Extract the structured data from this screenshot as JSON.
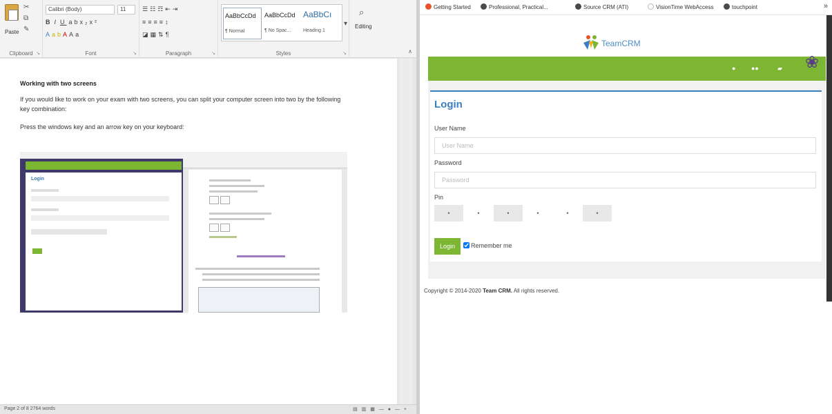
{
  "word": {
    "ribbon": {
      "clipboard": {
        "paste_label": "Paste",
        "group_label": "Clipboard"
      },
      "font": {
        "name": "Calibri (Body)",
        "size": "11",
        "group_label": "Font"
      },
      "paragraph": {
        "group_label": "Paragraph"
      },
      "styles": {
        "group_label": "Styles",
        "items": [
          {
            "preview": "AaBbCcDd",
            "name": "¶ Normal"
          },
          {
            "preview": "AaBbCcDd",
            "name": "¶ No Spac..."
          },
          {
            "preview": "AaBbCı",
            "name": "Heading 1"
          }
        ]
      },
      "editing": {
        "label": "Editing"
      }
    },
    "document": {
      "heading": "Working with two screens",
      "para1": "If you would like to work on your exam with two screens, you can split your computer screen into two by the following key combination:",
      "para2": "Press the windows key and an arrow key on your keyboard:",
      "thumb_title": "Login"
    },
    "status": {
      "left": "Page 2 of 8    2764 words"
    }
  },
  "browser": {
    "bookmarks": [
      {
        "label": "Getting Started",
        "color": "#e8532c"
      },
      {
        "label": "Professional, Practical...",
        "color": "#4a4a4a"
      },
      {
        "label": "Source CRM (ATI)",
        "color": "#4a4a4a"
      },
      {
        "label": "VisionTime WebAccess",
        "color": "#bbbbbb"
      },
      {
        "label": "touchpoint",
        "color": "#4a4a4a"
      }
    ],
    "more": "»",
    "site": {
      "logo_text": "TeamCRM",
      "accent": "#7cb632",
      "title_color": "#3a7fc1"
    },
    "login": {
      "title": "Login",
      "username_label": "User Name",
      "username_placeholder": "User Name",
      "password_label": "Password",
      "password_placeholder": "Password",
      "pin_label": "Pin",
      "pin_digits": [
        "•",
        "•",
        "•",
        "•",
        "•",
        "•"
      ],
      "button": "Login",
      "remember": "Remember me"
    },
    "footer": {
      "prefix": "Copyright © 2014-2020 ",
      "brand": "Team CRM.",
      "suffix": " All rights reserved."
    }
  }
}
